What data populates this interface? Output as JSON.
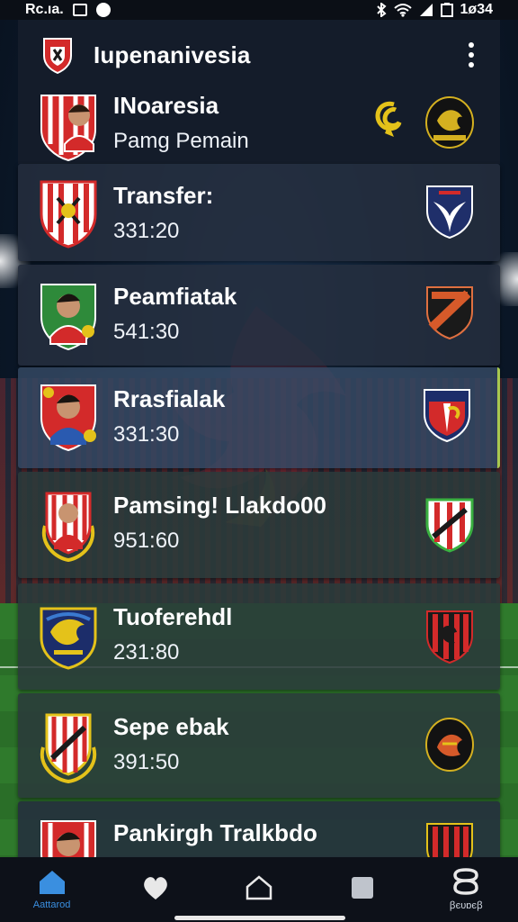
{
  "status_bar": {
    "time": "Rc.ıa.",
    "battery_text": "1ø34"
  },
  "header": {
    "title": "Iupenanivesia"
  },
  "rows": [
    {
      "name": "INoaresia",
      "sub": "Pamg Pemain"
    },
    {
      "name": "Transfer:",
      "sub": "331:20"
    },
    {
      "name": "Peamfiatak",
      "sub": "541:30"
    },
    {
      "name": "Rrasfialak",
      "sub": "331:30"
    },
    {
      "name": "Pamsing! Llakdo00",
      "sub": "951:60"
    },
    {
      "name": "Tuoferehdl",
      "sub": "231:80"
    },
    {
      "name": "Sepe ebak",
      "sub": "391:50"
    },
    {
      "name": "Pankirgh Tralkbdo",
      "sub": ""
    }
  ],
  "nav": [
    {
      "label": "Aattarod",
      "icon": "home-icon"
    },
    {
      "label": "",
      "icon": "heart-icon"
    },
    {
      "label": "",
      "icon": "house-outline-icon"
    },
    {
      "label": "",
      "icon": "square-icon"
    },
    {
      "label": "ꞵєυɒєꞵ",
      "icon": "team-icon"
    }
  ],
  "colors": {
    "accent": "#3a8fe0",
    "red": "#d32a2a",
    "gold": "#e4c21a"
  }
}
